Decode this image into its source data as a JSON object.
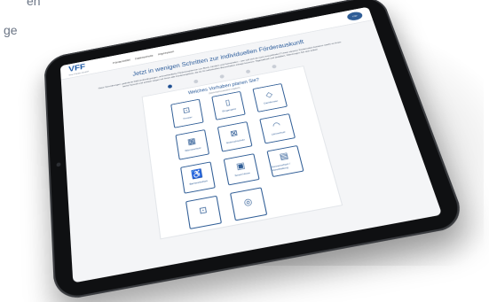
{
  "side": {
    "line1": "en",
    "line2": "ge"
  },
  "header": {
    "logo": "VFF",
    "logo_sub": "Ihre Förder-GmbH",
    "nav": [
      "Fördermittel",
      "Datenschutz",
      "Impressum"
    ],
    "badge": "TOP"
  },
  "hero": {
    "title": "Jetzt in wenigen Schritten zur individuellen Förderauskunft",
    "text": "Neue Verordnungen, geänderte Rahmenbedingungen, unterschiedliche Förderprogramme von Bund, Ländern und Gemeinden – wer soll sich da noch zurechtfinden? Unser cleverer Fördermittel-Assistent macht es Ihnen leicht! Schnell und einfach zeigen wir Ihnen alle Förderangebote, die für Ihr individuelles Bauvorhaben infrage kommen. Tagesaktuell und detailliert. Überzeugen Sie sich selbst!"
  },
  "steps": {
    "count": 5,
    "active": 0
  },
  "question": {
    "title": "Welches Vorhaben planen Sie?",
    "subtitle": "(Mehrfachauswahl möglich)"
  },
  "options": [
    {
      "label": "Fenster",
      "icon": "window-icon",
      "glyph": "⊡"
    },
    {
      "label": "Eingangstür",
      "icon": "door-icon",
      "glyph": "▯"
    },
    {
      "label": "Dachfenster",
      "icon": "roof-window-icon",
      "glyph": "◇"
    },
    {
      "label": "Wärmeschutz",
      "icon": "insulation-icon",
      "glyph": "▦"
    },
    {
      "label": "Einbruchschutz",
      "icon": "security-icon",
      "glyph": "⊠"
    },
    {
      "label": "Lärmschutz",
      "icon": "noise-icon",
      "glyph": "◠"
    },
    {
      "label": "Barrierefreiheit",
      "icon": "accessibility-icon",
      "glyph": "♿"
    },
    {
      "label": "Smart Home",
      "icon": "smart-home-icon",
      "glyph": "▣"
    },
    {
      "label": "Sonnenschutz / Verschattung",
      "icon": "shading-icon",
      "glyph": "▤"
    },
    {
      "label": "",
      "icon": "option-icon",
      "glyph": "⊡"
    },
    {
      "label": "",
      "icon": "option-icon",
      "glyph": "◎"
    }
  ]
}
